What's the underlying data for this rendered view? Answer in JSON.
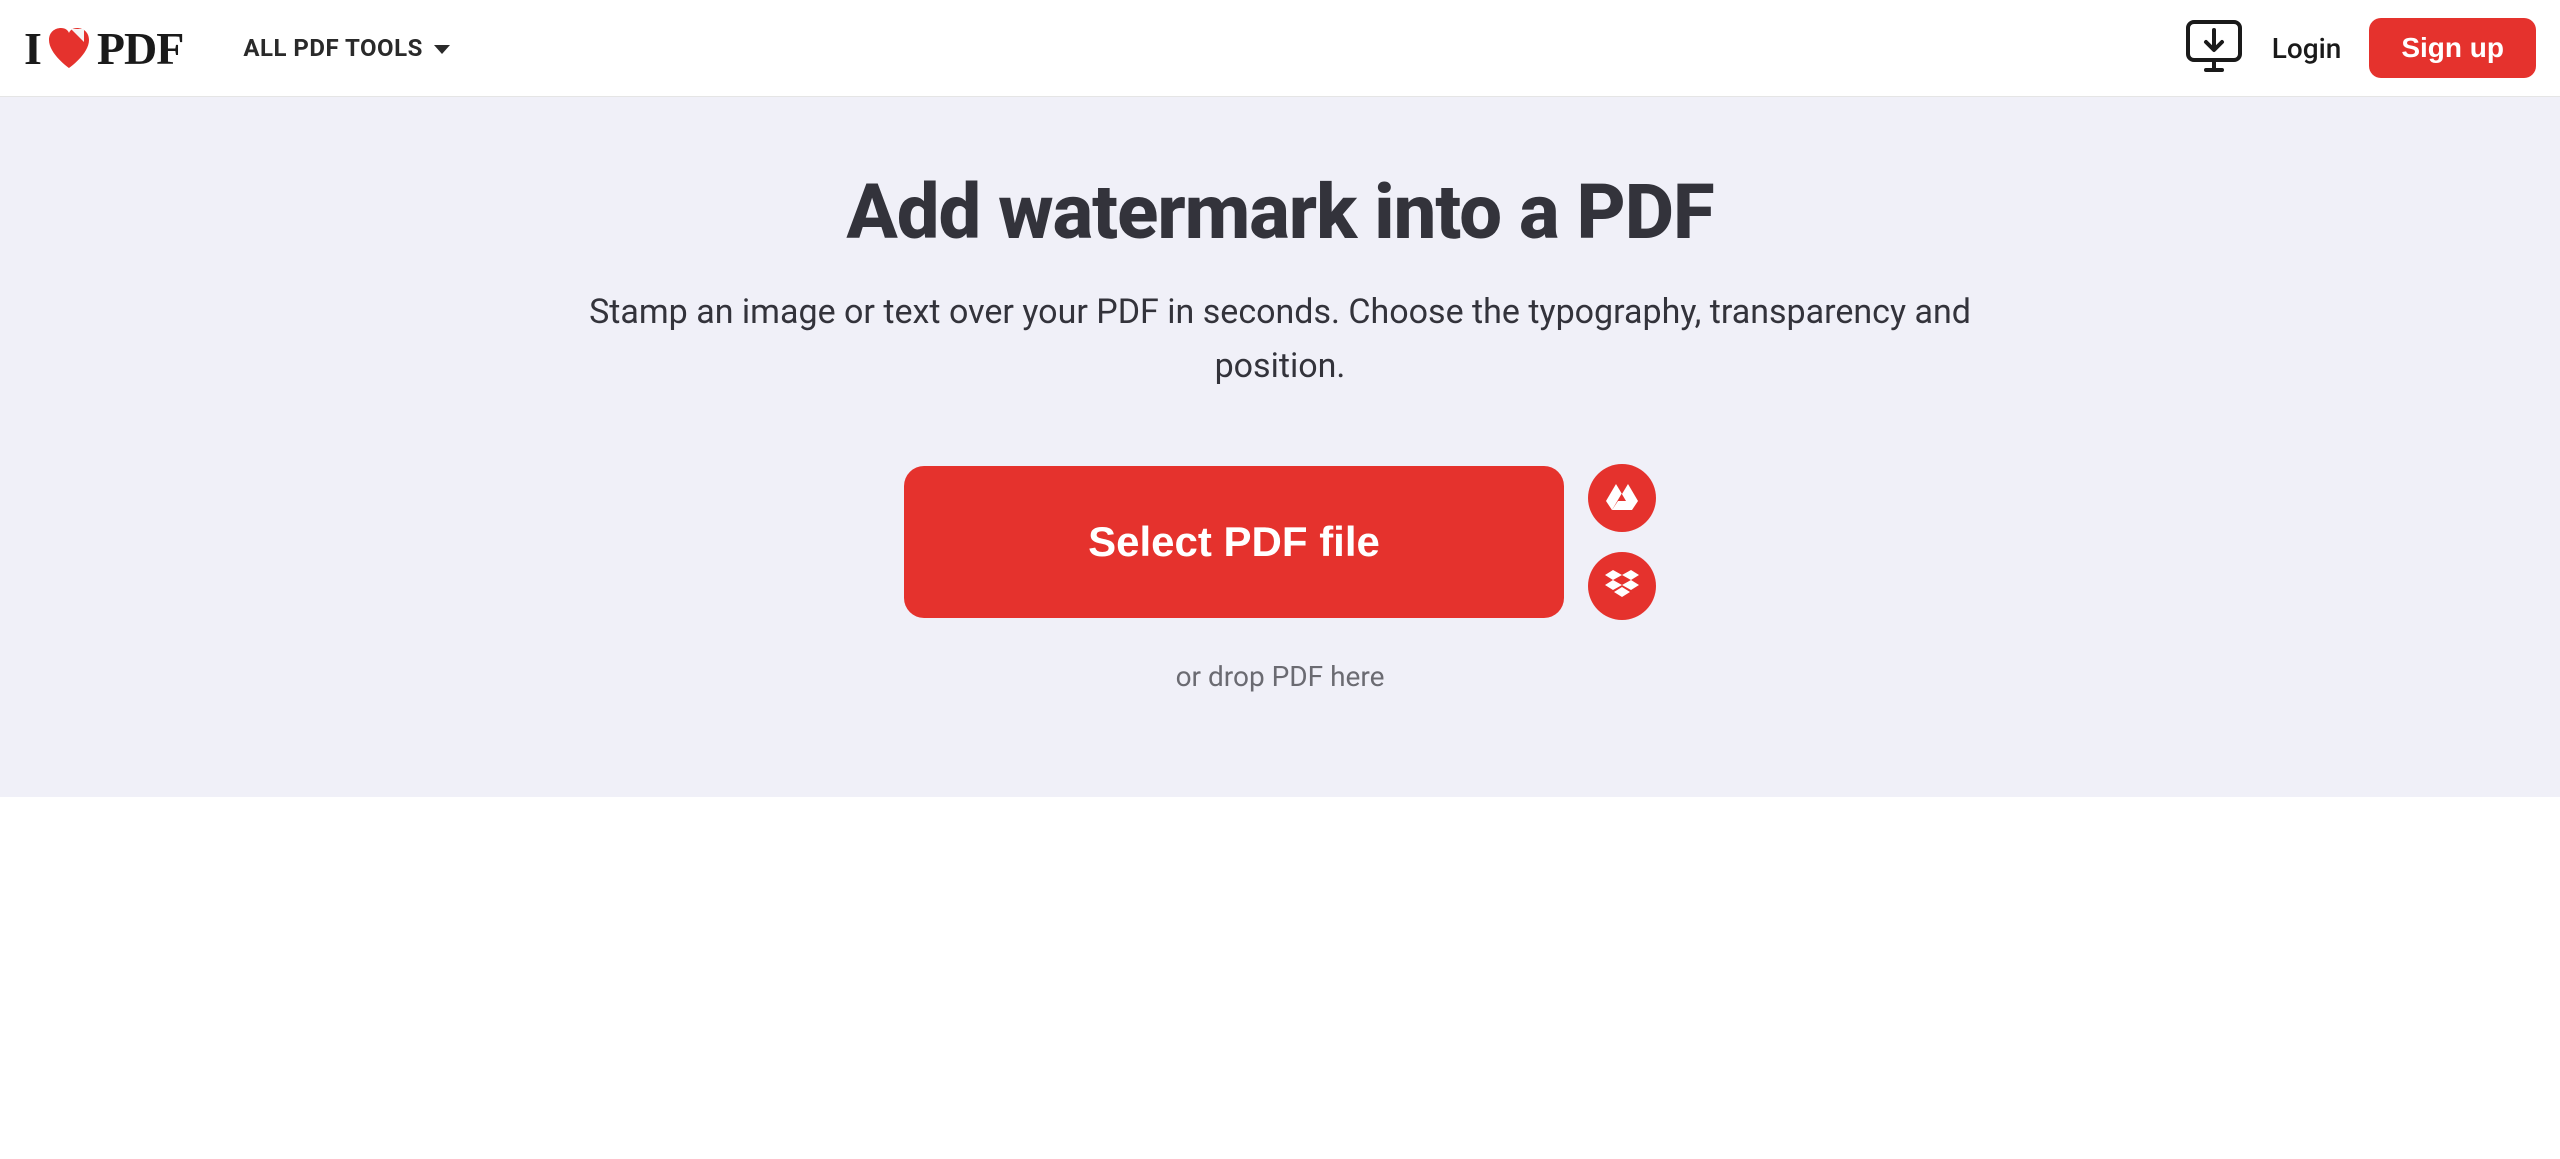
{
  "header": {
    "logo": {
      "prefix": "I",
      "suffix": "PDF"
    },
    "nav": {
      "all_tools_label": "ALL PDF TOOLS"
    },
    "login_label": "Login",
    "signup_label": "Sign up"
  },
  "main": {
    "title": "Add watermark into a PDF",
    "subtitle": "Stamp an image or text over your PDF in seconds. Choose the typography, transparency and position.",
    "select_button_label": "Select PDF file",
    "drop_hint": "or drop PDF here"
  },
  "colors": {
    "accent": "#e5322d",
    "text_dark": "#33333b",
    "bg_main": "#f0f0f8"
  }
}
